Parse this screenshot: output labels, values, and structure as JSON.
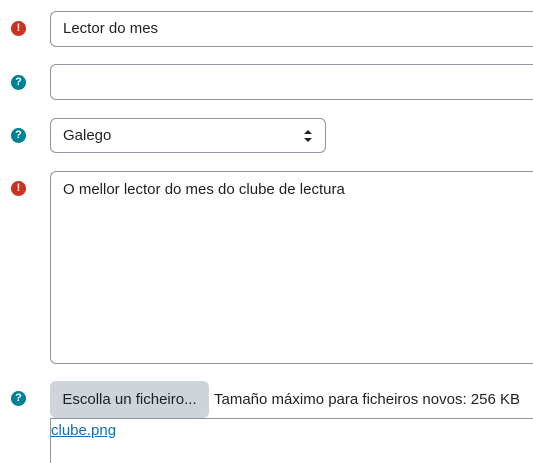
{
  "form": {
    "name_field": {
      "value": "Lector do mes",
      "status_icon": "exclamation-circle-icon",
      "status_glyph": "!"
    },
    "second_field": {
      "value": "",
      "status_icon": "question-circle-icon",
      "status_glyph": "?"
    },
    "language_select": {
      "selected": "Galego",
      "status_icon": "question-circle-icon",
      "status_glyph": "?"
    },
    "description_field": {
      "value": "O mellor lector do mes do clube de lectura",
      "status_icon": "exclamation-circle-icon",
      "status_glyph": "!"
    },
    "file_picker": {
      "status_icon": "question-circle-icon",
      "status_glyph": "?",
      "button_label": "Escolla un ficheiro...",
      "max_size_text": "Tamaño máximo para ficheiros novos: 256 KB",
      "file_name": "clube.png"
    }
  },
  "colors": {
    "required": "#ca3120",
    "help": "#008196",
    "link": "#0f6cbf",
    "border": "#8f959e",
    "button_bg": "#ced4da"
  }
}
